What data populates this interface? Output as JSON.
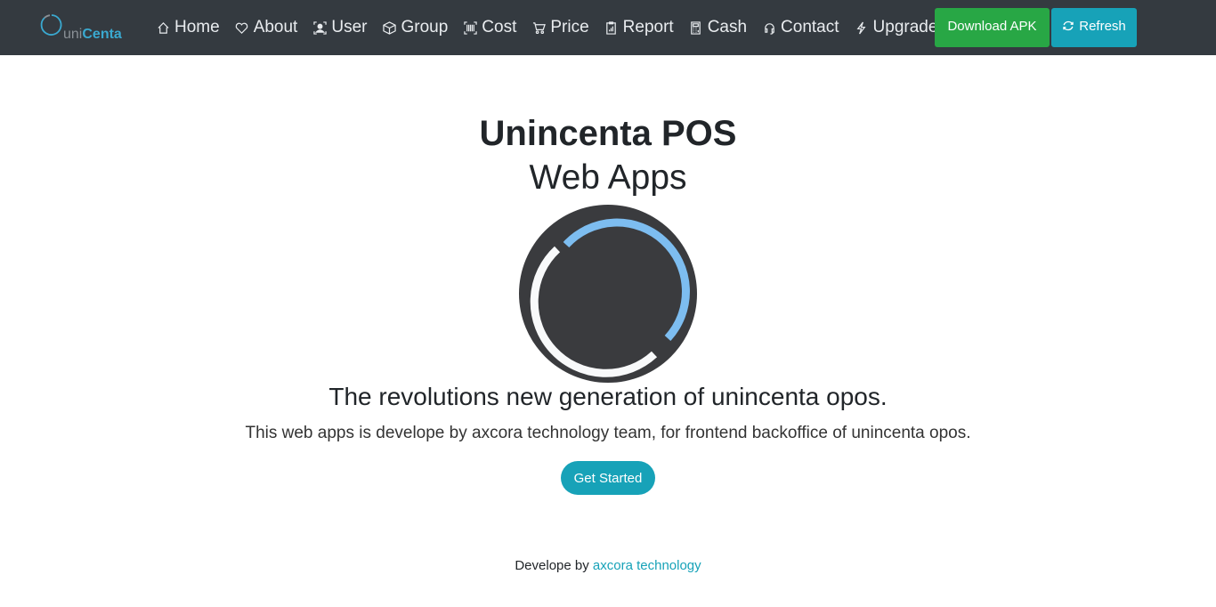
{
  "brand": {
    "part1": "uni",
    "part2": "Centa"
  },
  "nav": {
    "items": [
      {
        "label": "Home",
        "icon": "home-icon"
      },
      {
        "label": "About",
        "icon": "heart-icon"
      },
      {
        "label": "User",
        "icon": "user-icon"
      },
      {
        "label": "Group",
        "icon": "box-icon"
      },
      {
        "label": "Cost",
        "icon": "barcode-icon"
      },
      {
        "label": "Price",
        "icon": "cart-icon"
      },
      {
        "label": "Report",
        "icon": "clipboard-chart-icon"
      },
      {
        "label": "Cash",
        "icon": "calculator-icon"
      },
      {
        "label": "Contact",
        "icon": "headphones-icon"
      },
      {
        "label": "Upgrade",
        "icon": "lightning-icon"
      }
    ],
    "download_label": "Download APK",
    "refresh_label": "Refresh"
  },
  "hero": {
    "title": "Unincenta POS",
    "subtitle": "Web Apps",
    "tagline": "The revolutions new generation of unincenta opos.",
    "lead": "This web apps is develope by axcora technology team, for frontend backoffice of unincenta opos.",
    "cta_label": "Get Started"
  },
  "footer": {
    "prefix": "Develope by",
    "link_text": "axcora technology"
  },
  "colors": {
    "navbar": "#343a40",
    "success": "#28a745",
    "info": "#17a2b8",
    "logo_arc": "#7dbdf0",
    "logo_bg": "#3a3b3e"
  }
}
